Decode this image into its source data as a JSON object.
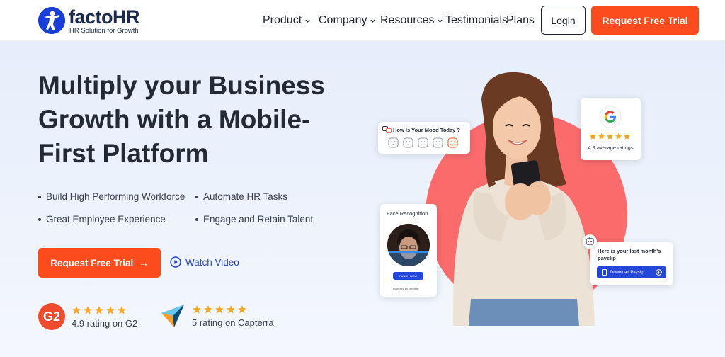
{
  "header": {
    "logo": {
      "name": "factoHR",
      "tagline": "HR Solution for Growth"
    },
    "nav": {
      "product": "Product",
      "company": "Company",
      "resources": "Resources",
      "testimonials": "Testimonials",
      "plans": "Plans"
    },
    "login_label": "Login",
    "trial_label": "Request Free Trial"
  },
  "hero": {
    "headline": "Multiply your Business Growth with a Mobile-First Platform",
    "bullets": [
      "Build High Performing Workforce",
      "Automate HR Tasks",
      "Great Employee Experience",
      "Engage and Retain Talent"
    ],
    "cta_label": "Request Free Trial",
    "cta_arrow": "→",
    "watch_label": "Watch Video",
    "ratings": {
      "g2": {
        "badge": "G2",
        "stars": 5,
        "text": "4.9 rating on G2"
      },
      "capterra": {
        "stars": 5,
        "text": "5 rating on Capterra"
      }
    }
  },
  "graphic": {
    "mood_card": {
      "title": "How Is Your Mood Today ?"
    },
    "google_card": {
      "stars": 5,
      "text": "4.9 average ratings"
    },
    "face_card": {
      "title": "Face Recognition",
      "button": "PUNCH NOW",
      "powered": "Powered by factoHR"
    },
    "payslip_card": {
      "title": "Here is your last month's payslip",
      "button": "Download Payslip"
    }
  },
  "colors": {
    "accent": "#fc4c1d",
    "brand_blue": "#2447d9",
    "hero_bg": "#e6eefb",
    "circle": "#fb6b6b",
    "star": "#f5a623"
  }
}
